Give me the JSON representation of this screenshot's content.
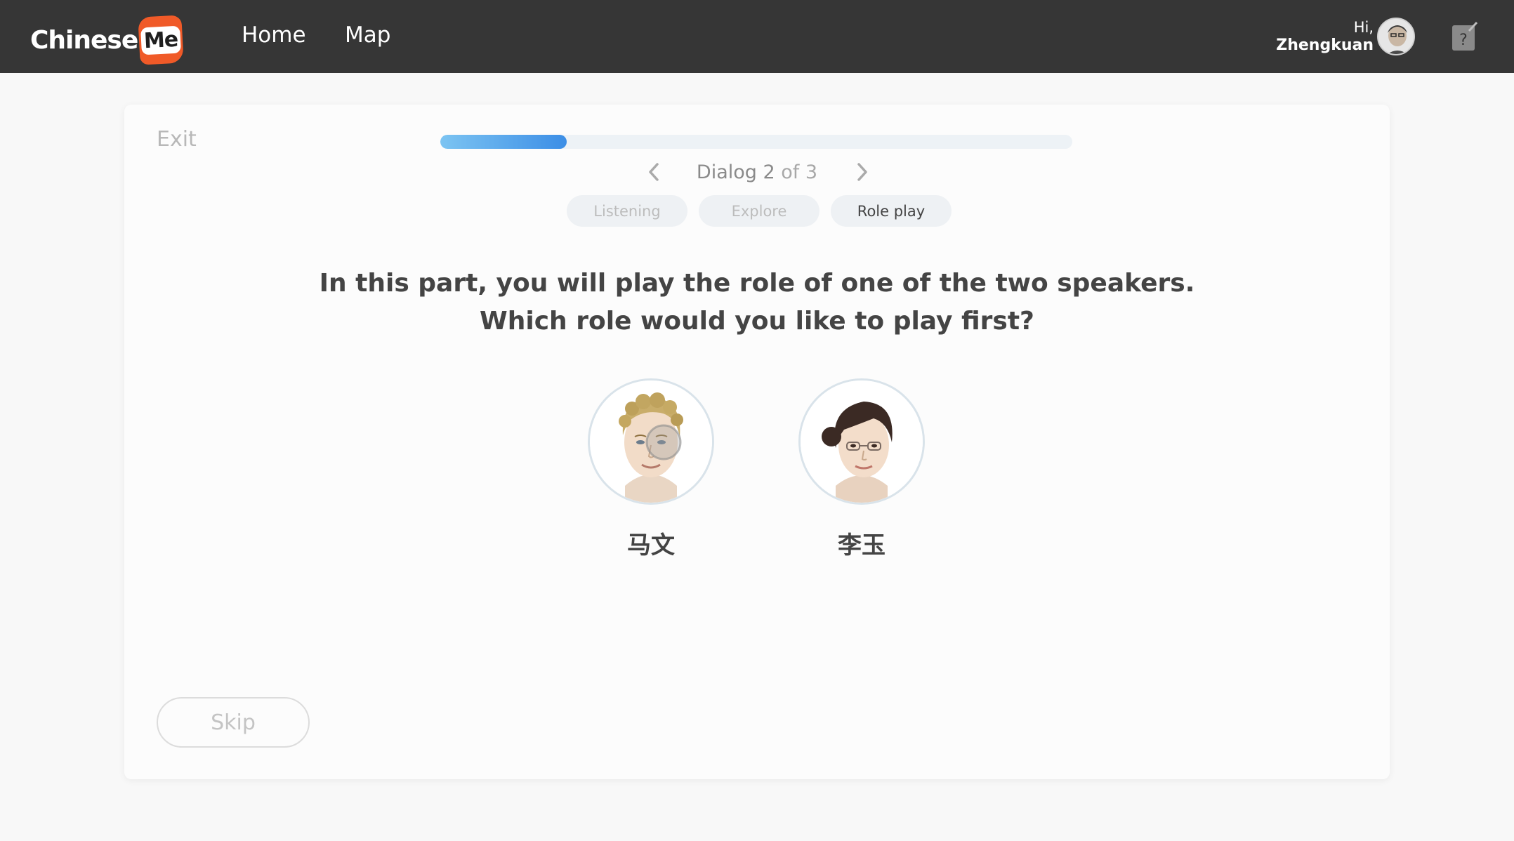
{
  "navbar": {
    "logo_text": "Chinese",
    "logo_badge": "Me",
    "links": [
      {
        "label": "Home"
      },
      {
        "label": "Map"
      }
    ],
    "user": {
      "greeting": "Hi,",
      "name": "Zhengkuan"
    },
    "help_icon": "help-note-icon"
  },
  "lesson": {
    "exit_label": "Exit",
    "progress_fraction": 0.2,
    "dialog": {
      "label": "Dialog 2",
      "of_label": "of 3"
    },
    "tabs": [
      {
        "label": "Listening",
        "active": false
      },
      {
        "label": "Explore",
        "active": false
      },
      {
        "label": "Role play",
        "active": true
      }
    ],
    "prompt_line1": "In this part, you will play the role of one of the two speakers.",
    "prompt_line2": "Which role would you like to play first?",
    "roles": [
      {
        "name": "马文"
      },
      {
        "name": "李玉"
      }
    ],
    "skip_label": "Skip"
  },
  "colors": {
    "navbar_bg": "#363636",
    "brand_orange": "#f05a28",
    "progress_start": "#7cc4f2",
    "progress_end": "#3c8ee6"
  }
}
